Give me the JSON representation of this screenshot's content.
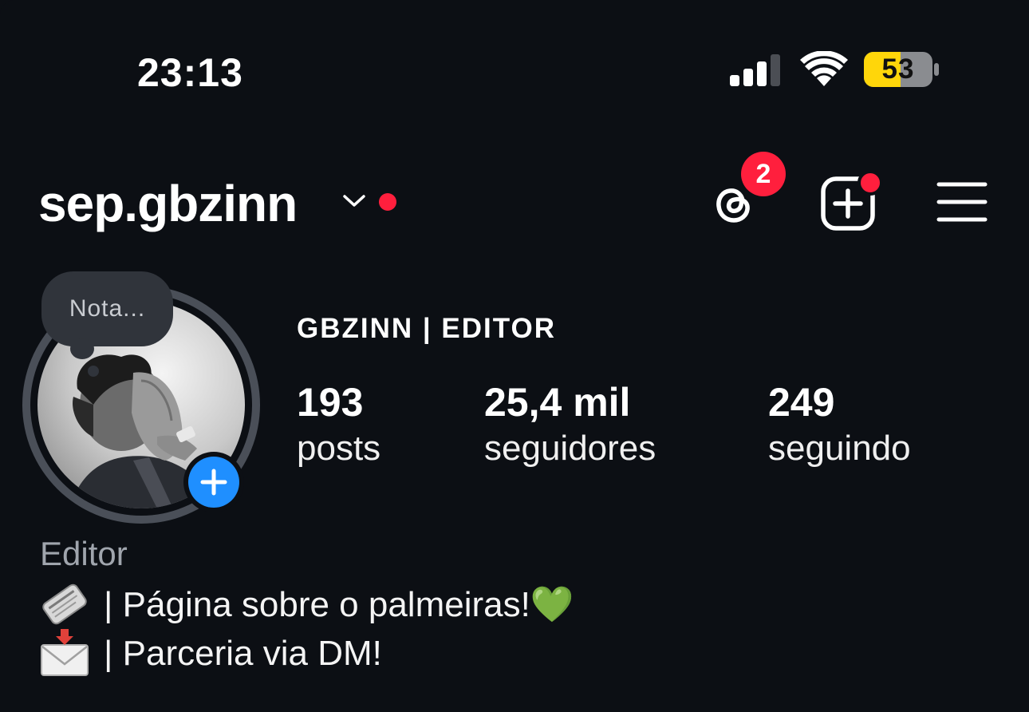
{
  "status_bar": {
    "time": "23:13",
    "battery": "53",
    "signal_icon": "cellular-signal-icon",
    "wifi_icon": "wifi-icon"
  },
  "header": {
    "username": "sep.gbzinn",
    "threads_badge": "2",
    "icons": [
      "chevron-down-icon",
      "threads-icon",
      "add-post-icon",
      "hamburger-menu-icon"
    ]
  },
  "profile": {
    "note": "Nota...",
    "display_name": "GBZINN | EDITOR",
    "stats": [
      {
        "value": "193",
        "label": "posts"
      },
      {
        "value": "25,4 mil",
        "label": "seguidores"
      },
      {
        "value": "249",
        "label": "seguindo"
      }
    ],
    "category": "Editor",
    "bio": [
      {
        "icon": "newspaper-icon",
        "text": "| Página sobre o palmeiras!💚"
      },
      {
        "icon": "envelope-icon",
        "text": "| Parceria via DM!"
      }
    ]
  },
  "colors": {
    "background": "#0c0f14",
    "notification_red": "#ff1f3d",
    "accent_blue": "#1f8fff",
    "battery_yellow": "#ffd60a"
  }
}
